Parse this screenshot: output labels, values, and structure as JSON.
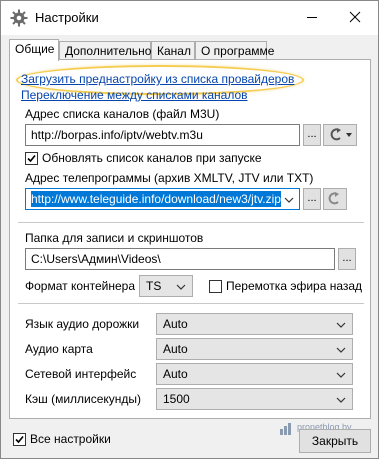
{
  "window": {
    "title": "Настройки"
  },
  "tabs": [
    {
      "label": "Общие"
    },
    {
      "label": "Дополнительно"
    },
    {
      "label": "Канал"
    },
    {
      "label": "О программе"
    }
  ],
  "general": {
    "load_preset_link": "Загрузить преднастройку из списка провайдеров",
    "switch_lists_link": "Переключение между списками каналов",
    "channel_list_label": "Адрес списка каналов (файл M3U)",
    "channel_list_value": "http://borpas.info/iptv/webtv.m3u",
    "update_on_start_label": "Обновлять список каналов при запуске",
    "update_on_start_checked": true,
    "epg_label": "Адрес телепрограммы (архив XMLTV, JTV или TXT)",
    "epg_value": "http://www.teleguide.info/download/new3/jtv.zip",
    "browse_label": "...",
    "record_folder_label": "Папка для записи и скриншотов",
    "record_folder_value": "C:\\Users\\Админ\\Videos\\",
    "container_label": "Формат контейнера",
    "container_value": "TS",
    "rewind_label": "Перемотка эфира назад",
    "rewind_checked": false,
    "audio_track_label": "Язык аудио дорожки",
    "audio_track_value": "Auto",
    "audio_card_label": "Аудио карта",
    "audio_card_value": "Auto",
    "network_label": "Сетевой интерфейс",
    "network_value": "Auto",
    "cache_label": "Кэш (миллисекунды)",
    "cache_value": "1500"
  },
  "footer": {
    "all_settings_label": "Все настройки",
    "all_settings_checked": true,
    "close_label": "Закрыть",
    "watermark": "pronetblog.by"
  },
  "colors": {
    "link": "#0645ad",
    "highlight": "#f5cd53",
    "selection": "#0078d7"
  }
}
